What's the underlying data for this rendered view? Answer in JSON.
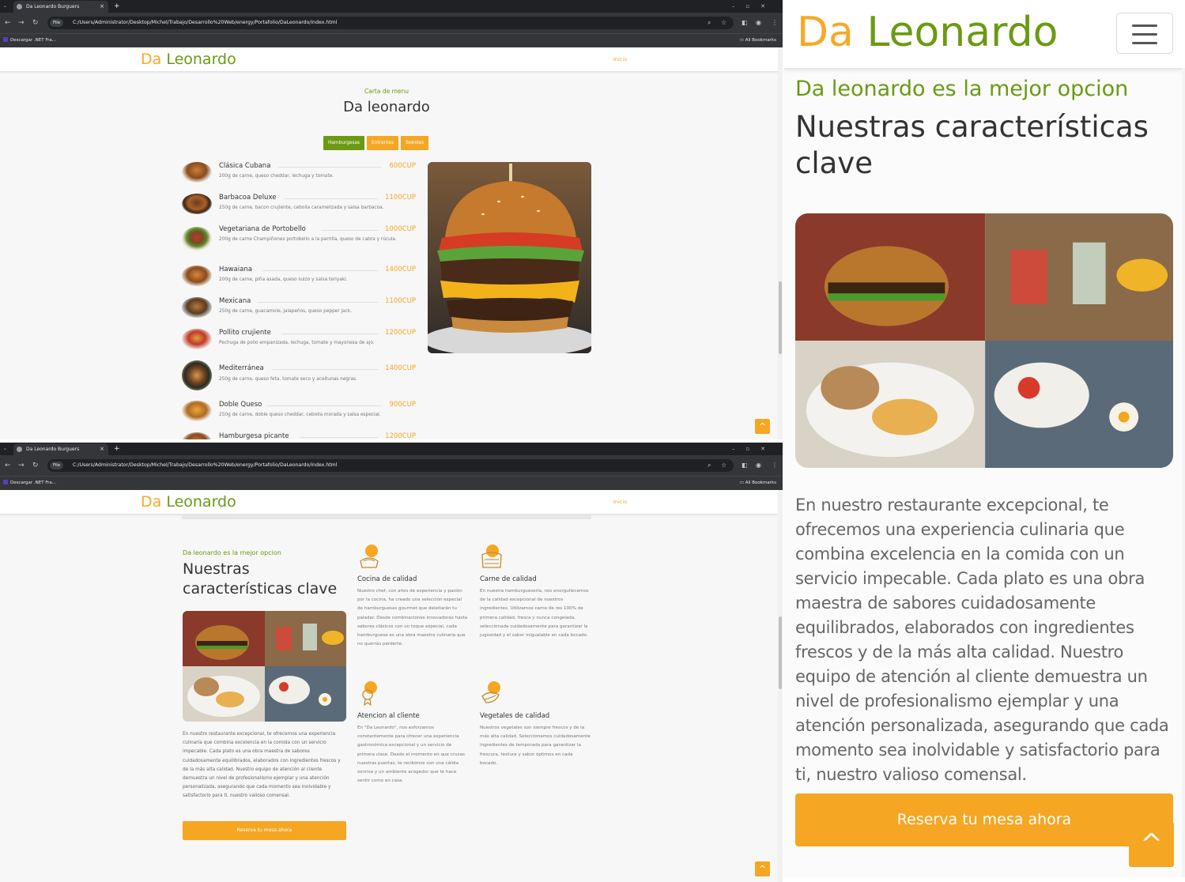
{
  "browser": {
    "tab_title": "Da Leonardo Burguers",
    "file_badge": "File",
    "url": "C:/Users/Administrator/Desktop/Michel/Trabajo/Desarrollo%20Web/energy/Portafolio/DaLeonardo/index.html",
    "bookmark_1": "Descargar .NET Fra...",
    "bookmark_2": "All Bookmarks",
    "new_tab": "+",
    "tab_close": "×"
  },
  "site": {
    "logo_part1": "Da",
    "logo_part2": "Leonardo",
    "nav_inicio": "Inicio",
    "scroll_top": "^"
  },
  "menu": {
    "subtitle": "Carta de menu",
    "title": "Da leonardo",
    "tabs": [
      {
        "label": "Hamburgesas",
        "color": "#6a9a12"
      },
      {
        "label": "Entrantes",
        "color": "#f5a623"
      },
      {
        "label": "Bebidas",
        "color": "#f5a623"
      }
    ],
    "items": [
      {
        "name": "Clásica Cubana",
        "price": "600CUP",
        "desc": "200g de carne, queso cheddar, lechuga y tomate."
      },
      {
        "name": "Barbacoa Deluxe",
        "price": "1100CUP",
        "desc": "250g de carne, bacon crujiente, cebolla caramelizada y salsa barbacoa."
      },
      {
        "name": "Vegetariana de Portobello",
        "price": "1000CUP",
        "desc": "200g de carne Champiñones portobello a la parrilla, queso de cabra y rúcula."
      },
      {
        "name": "Hawaiana",
        "price": "1400CUP",
        "desc": "200g de carne, piña asada, queso suizo y salsa teriyaki."
      },
      {
        "name": "Mexicana",
        "price": "1100CUP",
        "desc": "250g de carne, guacamole, jalapeños, queso pepper jack."
      },
      {
        "name": "Pollito crujiente",
        "price": "1200CUP",
        "desc": "Pechuga de pollo empanizada, lechuga, tomate y mayonesa de ajo."
      },
      {
        "name": "Mediterránea",
        "price": "1400CUP",
        "desc": "250g de carne, queso feta, tomate seco y aceitunas negras."
      },
      {
        "name": "Doble Queso",
        "price": "900CUP",
        "desc": "250g de carne, doble queso cheddar, cebolla morada y salsa especial."
      },
      {
        "name": "Hamburgesa picante",
        "price": "1200CUP",
        "desc": ""
      }
    ]
  },
  "features": {
    "subtitle": "Da leonardo es la mejor opcion",
    "title": "Nuestras características clave",
    "paragraph": "En nuestro restaurante excepcional, te ofrecemos una experiencia culinaria que combina excelencia en la comida con un servicio impecable. Cada plato es una obra maestra de sabores cuidadosamente equilibrados, elaborados con ingredientes frescos y de la más alta calidad. Nuestro equipo de atención al cliente demuestra un nivel de profesionalismo ejemplar y una atención personalizada, asegurando que cada momento sea inolvidable y satisfactorio para ti, nuestro valioso comensal.",
    "reserve_label": "Reserva tu mesa ahora",
    "cards": [
      {
        "title": "Cocina de calidad",
        "text": "Nuestro chef, con años de experiencia y pasión por la cocina, ha creado una selección especial de hamburguesas gourmet que deleitarán tu paladar. Desde combinaciones innovadoras hasta sabores clásicos con un toque especial, cada hamburguesa es una obra maestra culinaria que no querrás perderte."
      },
      {
        "title": "Carne de calidad",
        "text": "En nuestra hamburguesería, nos enorgullecemos de la calidad excepcional de nuestros ingredientes. Utilizamos carne de res 100% de primera calidad, fresca y nunca congelada, seleccionada cuidadosamente para garantizar la jugosidad y el sabor inigualable en cada bocado."
      },
      {
        "title": "Atencion al cliente",
        "text": "En \"Da Leonardo\", nos esforzamos constantemente para ofrecer una experiencia gastronómica excepcional y un servicio de primera clase. Desde el momento en que cruzas nuestras puertas, te recibimos con una cálida sonrisa y un ambiente acogedor que te hace sentir como en casa."
      },
      {
        "title": "Vegetales de calidad",
        "text": "Nuestros vegetales son siempre frescos y de la más alta calidad. Seleccionamos cuidadosamente ingredientes de temporada para garantizar la frescura, textura y sabor óptimos en cada bocado."
      }
    ]
  },
  "colors": {
    "accent_orange": "#f5a623",
    "accent_green": "#6a9a12"
  }
}
